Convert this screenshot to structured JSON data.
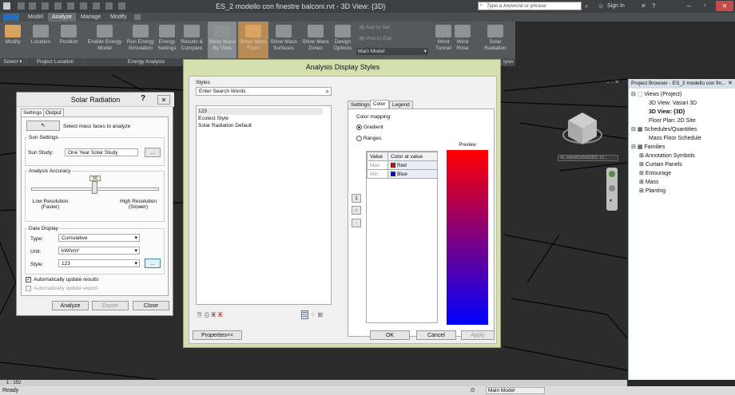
{
  "titlebar": {
    "document_title": "ES_2 modello con finestre balconi.rvt - 3D View: {3D}",
    "search_placeholder": "Type a keyword or phrase",
    "sign_in": "Sign In"
  },
  "ribbon": {
    "tabs": [
      "Model",
      "Analyze",
      "Manage",
      "Modify"
    ],
    "active_tab": "Analyze",
    "buttons": [
      "Modify",
      "Location",
      "Position",
      "Enable Energy Model",
      "Run Energy Simulation",
      "Energy Settings",
      "Results & Compare",
      "Show Mass By View",
      "Show Mass Form",
      "Show Mass Surfaces",
      "Show Mass Zones",
      "Design Options",
      "Add to Set",
      "Pick to Edit",
      "Wind Tunnel",
      "Wind Rose",
      "Solar Radiation"
    ],
    "panels": [
      "Select",
      "Project Location",
      "Energy Analysis",
      "lysis"
    ],
    "design_option_value": "Main Model"
  },
  "solar": {
    "title": "Solar Radiation",
    "tabs": [
      "Settings",
      "Output"
    ],
    "select_hint": "Select mass faces to analyze",
    "sun_settings_label": "Sun Settings",
    "sun_study_label": "Sun Study:",
    "sun_study_value": "One Year Solar Study",
    "ellipsis": "...",
    "accuracy_label": "Analysis Accuracy",
    "accuracy_value": "50",
    "accuracy_level": 0.5,
    "low_res": "Low Resolution",
    "low_res_sub": "(Faster)",
    "high_res": "High Resolution",
    "high_res_sub": "(Slower)",
    "data_display_label": "Data Display",
    "type_label": "Type:",
    "type_value": "Cumulative",
    "unit_label": "Unit:",
    "unit_value": "kWh/m²",
    "style_label": "Style:",
    "style_value": "123",
    "auto_update": "Automatically update results",
    "auto_export": "Automatically update export",
    "analyze": "Analyze",
    "export": "Export",
    "close": "Close"
  },
  "ads": {
    "title": "Analysis Display Styles",
    "styles_label": "Styles",
    "search_placeholder": "Enter Search Words",
    "styles": [
      "123",
      "Ecotect Style",
      "Solar Radiation Default"
    ],
    "tabs": [
      "Settings",
      "Color",
      "Legend"
    ],
    "active_tab": "Color",
    "color_mapping": "Color mapping:",
    "gradient": "Gradient",
    "ranges": "Ranges",
    "col_value": "Value",
    "col_color": "Color at value",
    "rows": [
      {
        "value": "Max",
        "color_name": "Red",
        "color": "#ff0000"
      },
      {
        "value": "Min",
        "color_name": "Blue",
        "color": "#0000ff"
      }
    ],
    "preview": "Preview",
    "index": "1",
    "properties": "Properties<<",
    "ok": "OK",
    "cancel": "Cancel",
    "apply": "Apply"
  },
  "browser": {
    "title": "Project Browser - ES_2 modello con fin...",
    "items": [
      "Views (Project)",
      "3D View: Vasari 3D",
      "3D View: {3D}",
      "Floor Plan: 2D Site",
      "Schedules/Quantities",
      "Mass Floor Schedule",
      "Families",
      "Annotation Symbols",
      "Curtain Panels",
      "Entourage",
      "Mass",
      "Planting"
    ]
  },
  "viewcube_coord": "41.9654632506352.12...",
  "scale": "1 : 192",
  "status": {
    "text": "Ready",
    "model": "Main Model",
    "zero": ":0"
  }
}
